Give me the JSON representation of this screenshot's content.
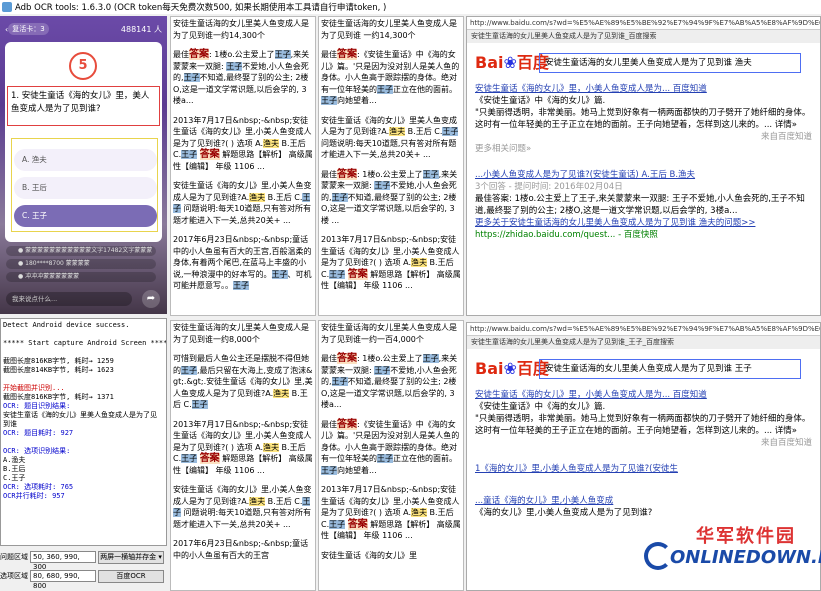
{
  "window": {
    "title": "Adb OCR tools: 1.6.3.0 (OCR token每天免费次数500, 如果长期使用本工具请自行申请token, )"
  },
  "phone": {
    "level": "复活卡：3",
    "viewers": "488141 人",
    "timer": "5",
    "question": "1. 安徒生童话《海的女儿》里，美人鱼变成人是为了见到谁?",
    "options": [
      {
        "label": "A. 渔夫"
      },
      {
        "label": "B. 王后"
      },
      {
        "label": "C. 王子"
      }
    ],
    "chat": [
      "● 蒙蒙蒙蒙蒙蒙蒙蒙蒙蒙蒙文字17482文字蒙蒙蒙",
      "● 180****8700 蒙蒙蒙蒙",
      "● 冲冲冲蒙蒙蒙蒙蒙蒙"
    ],
    "input_placeholder": "我来说点什么...",
    "share": "➦"
  },
  "log": {
    "lines": [
      {
        "t": "Detect Android device success.",
        "c": ""
      },
      {
        "t": "",
        "c": ""
      },
      {
        "t": "***** Start capture Android Screen *****",
        "c": ""
      },
      {
        "t": "",
        "c": ""
      },
      {
        "t": "截图长度816KB字节, 耗时→ 1259",
        "c": ""
      },
      {
        "t": "截图长度814KB字节, 耗时→ 1623",
        "c": ""
      },
      {
        "t": "",
        "c": ""
      },
      {
        "t": "开始截图并识别...",
        "c": "r"
      },
      {
        "t": "截图长度816KB字节, 耗时→ 1371",
        "c": ""
      },
      {
        "t": "OCR: 题目识别结果:",
        "c": "b"
      },
      {
        "t": "安徒生童话《海的女儿》里美人鱼变成人是为了见",
        "c": ""
      },
      {
        "t": "到谁",
        "c": ""
      },
      {
        "t": "OCR: 题目耗时: 927",
        "c": "b"
      },
      {
        "t": "",
        "c": ""
      },
      {
        "t": "OCR: 选项识别结果:",
        "c": "b"
      },
      {
        "t": "A.渔夫",
        "c": ""
      },
      {
        "t": "B.王后",
        "c": ""
      },
      {
        "t": "C.王子",
        "c": ""
      },
      {
        "t": "OCR: 选项耗时: 765",
        "c": "b"
      },
      {
        "t": "OCR并行耗时: 957",
        "c": "b"
      }
    ]
  },
  "config": {
    "q_label": "问题区域",
    "q_value": "50, 360, 990, 300",
    "q_btn": "两屏一横轴并存金 ▾",
    "o_label": "选项区域",
    "o_value": "80, 680, 990, 800",
    "o_btn": "百度OCR"
  },
  "panes": [
    {
      "blocks": [
        "安徒生童话海的女儿里美人鱼变成人是为了见到谁一约14,300个",
        "最佳答案: 1楼o.公主爱上了王子,来关蒙蒙来一双腿: 王子不爱她,小人鱼会死的,王子不知道,最终娶了别的公主; 2楼O,这是一道文学常识题,以后会学的, 3楼a...",
        "2013年7月17日&nbsp;-&nbsp;安徒生童话《海的女儿》里,小美人鱼变成人是为了见到谁?( ) 选项 A.渔夫 B.王后 C.王子 答案 解题思路【解析】 高级属性【编辑】 年级 1106 ...",
        "安徒生童话《海的女儿》里,小美人鱼变成人是为了见到谁?A.渔夫 B.王后 C.王子 问题说明:每天10道题,只有答对所有题才能进入下一关,总共20关+ ...",
        "2017年6月23日&nbsp;-&nbsp;童话中的小人鱼虽有百大的王宫,百般温柔的身体,有着两个尾巴,在蓝马上丰盛的小说,一种浪漫中的好本写的。王子、可机可能并愿意写。。王子"
      ]
    },
    {
      "blocks": [
        "安徒生童话海的女儿里美人鱼变成人是为了见到谁 一约14,300个",
        "最佳答案:《安徒生童话》中《海的女儿》篇。'只是因为没对别人是美人鱼的身体。小人鱼高于跟踪摆的身体。绝对有一位年轻美的王子正立在他的面前。王子向她望着...",
        "安徒生童话《海的女儿》里美人鱼变成人是为了见到谁?A.渔夫 B.王后 C.王子 问题说明:每天10道题,只有答对所有题才能进入下一关,总共20关+ ...",
        "最佳答案: 1楼o.公主爱上了王子,来关蒙蒙来一双腿: 王子不爱她,小人鱼会死的,王子不知道,最终娶了别的公主; 2楼O,这是一道文学常识题,以后会学的, 3楼 ...",
        "2013年7月17日&nbsp;-&nbsp;安徒生童话《海的女儿》里,小美人鱼变成人是为了见到谁?( ) 选项 A.渔夫 B.王后 C.王子 答案 解题思路【解析】 高级属性【编辑】 年级 1106 ..."
      ]
    },
    {
      "blocks": [
        "安徒生童话海的女儿里美人鱼变成人是为了见到谁一约8,000个",
        "可惜到最后人鱼公主还是摆脱不得但她的王子,最后只留在大海上,变成了泡沫&gt;.&gt;.安徒生童话《海的女儿》里,美人鱼变成人是为了见到谁?A.渔夫 B.王后 C.王子",
        "2013年7月17日&nbsp;-&nbsp;安徒生童话《海的女儿》里,小美人鱼变成人是为了见到谁?( ) 选项 A.渔夫 B.王后 C.王子 答案 解题思路【解析】 高级属性【编辑】 年级 1106 ...",
        "安徒生童话《海的女儿》里,小美人鱼变成人是为了见到谁?A.渔夫 B.王后 C.王子 问题说明:每天10道题,只有答对所有题才能进入下一关,总共20关+ ...",
        "2017年6月23日&nbsp;-&nbsp;童话中的小人鱼虽有百大的王宫"
      ]
    },
    {
      "blocks": [
        "安徒生童话海的女儿里美人鱼变成人是为了见到谁一约一百4,000个",
        "最佳答案: 1楼o.公主爱上了王子,来关蒙蒙来一双腿: 王子不爱她,小人鱼会死的,王子不知道,最终娶了别的公主; 2楼O,这是一道文学常识题,以后会学的, 3楼a...",
        "最佳答案:《安徒生童话》中《海的女儿》篇。'只是因为没对别人是美人鱼的身体。小人鱼高于跟踪摆的身体。绝对有一位年轻美的王子正立在他的面前。王子向她望着...",
        "2013年7月17日&nbsp;-&nbsp;安徒生童话《海的女儿》里,小美人鱼变成人是为了见到谁?( ) 选项 A.渔夫 B.王后 C.王子 答案 解题思路【解析】 高级属性【编辑】 年级 1106 ...",
        "安徒生童话《海的女儿》里"
      ]
    }
  ],
  "browser_top": {
    "url": "http://www.baidu.com/s?wd=%E5%AE%89%E5%BE%92%E7%94%9F%E7%AB%A5%E8%AF%9D%E6%B5%B7%E7%9A%84",
    "tab": "安徒生童话海的女儿里美人鱼变成人是为了见到谁_百度搜索",
    "logo_a": "Bai",
    "logo_b": "百度",
    "query": "安徒生童话海的女儿里美人鱼变成人是为了见到谁 渔夫",
    "r1_title": "安徒生童话《海的女儿》里，小美人鱼变成人是为... 百度知道",
    "r1_sub": "《安徒生童话》中《海的女儿》篇.",
    "r1_body": "\"只美丽得透明，非常美丽。她马上觉到好象有一柄两面都快的刀子劈开了她纤细的身体。这时有一位年轻美的王子正立在她的面前。王子向她望着，怎样到这儿来的。... 详情»",
    "r1_date": "来自百度知道",
    "r1_more": "更多相关问题»",
    "r2_title": "...小美人鱼变成人是为了见谁?(安徒生童话) A.王后 B.渔夫",
    "r2_meta": "3个回答 - 提问时间: 2016年02月04日",
    "r2_body": "最佳答案: 1楼o.公主爱上了王子,来关蒙蒙来一双腿: 王子不爱她,小人鱼会死的,王子不知道,最终娶了别的公主; 2楼O,这是一道文学常识题,以后会学的, 3楼a...",
    "r2_link": "更多关于安徒生童话海的女儿里美人鱼变成人是为了见到谁 渔夫的问题>>",
    "r2_url": "https://zhidao.baidu.com/quest... - 百度快照"
  },
  "browser_bottom": {
    "url": "http://www.baidu.com/s?wd=%E5%AE%89%E5%BE%92%E7%94%9F%E7%AB%A5%E8%AF%9D%E6%B5%B7%E7%9A%84",
    "tab": "安徒生童话海的女儿里美人鱼变成人是为了见到谁_王子_百度搜索",
    "logo_a": "Bai",
    "logo_b": "百度",
    "query": "安徒生童话海的女儿里美人鱼变成人是为了见到谁 王子",
    "r1_title": "安徒生童话《海的女儿》里，小美人鱼变成人是为... 百度知道",
    "r1_sub": "《安徒生童话》中《海的女儿》篇.",
    "r1_body": "\"只美丽得透明，非常美丽。她马上觉到好象有一柄两面都快的刀子劈开了她纤细的身体。这时有一位年轻美的王子正立在她的面前。王子向她望着，怎样到这儿来的。... 详情»",
    "r1_date": "来自百度知道",
    "r2_title": "1《海的女儿》里,小美人鱼变成人是为了见谁?(安徒生",
    "r3_title": "...童话《海的女儿》里,小美人鱼变成",
    "r3_body": "《海的女儿》里,小美人鱼变成人是为了见到谁?"
  },
  "watermark": {
    "cn": "华军软件园",
    "en": "ONLINEDOWN.NET"
  }
}
